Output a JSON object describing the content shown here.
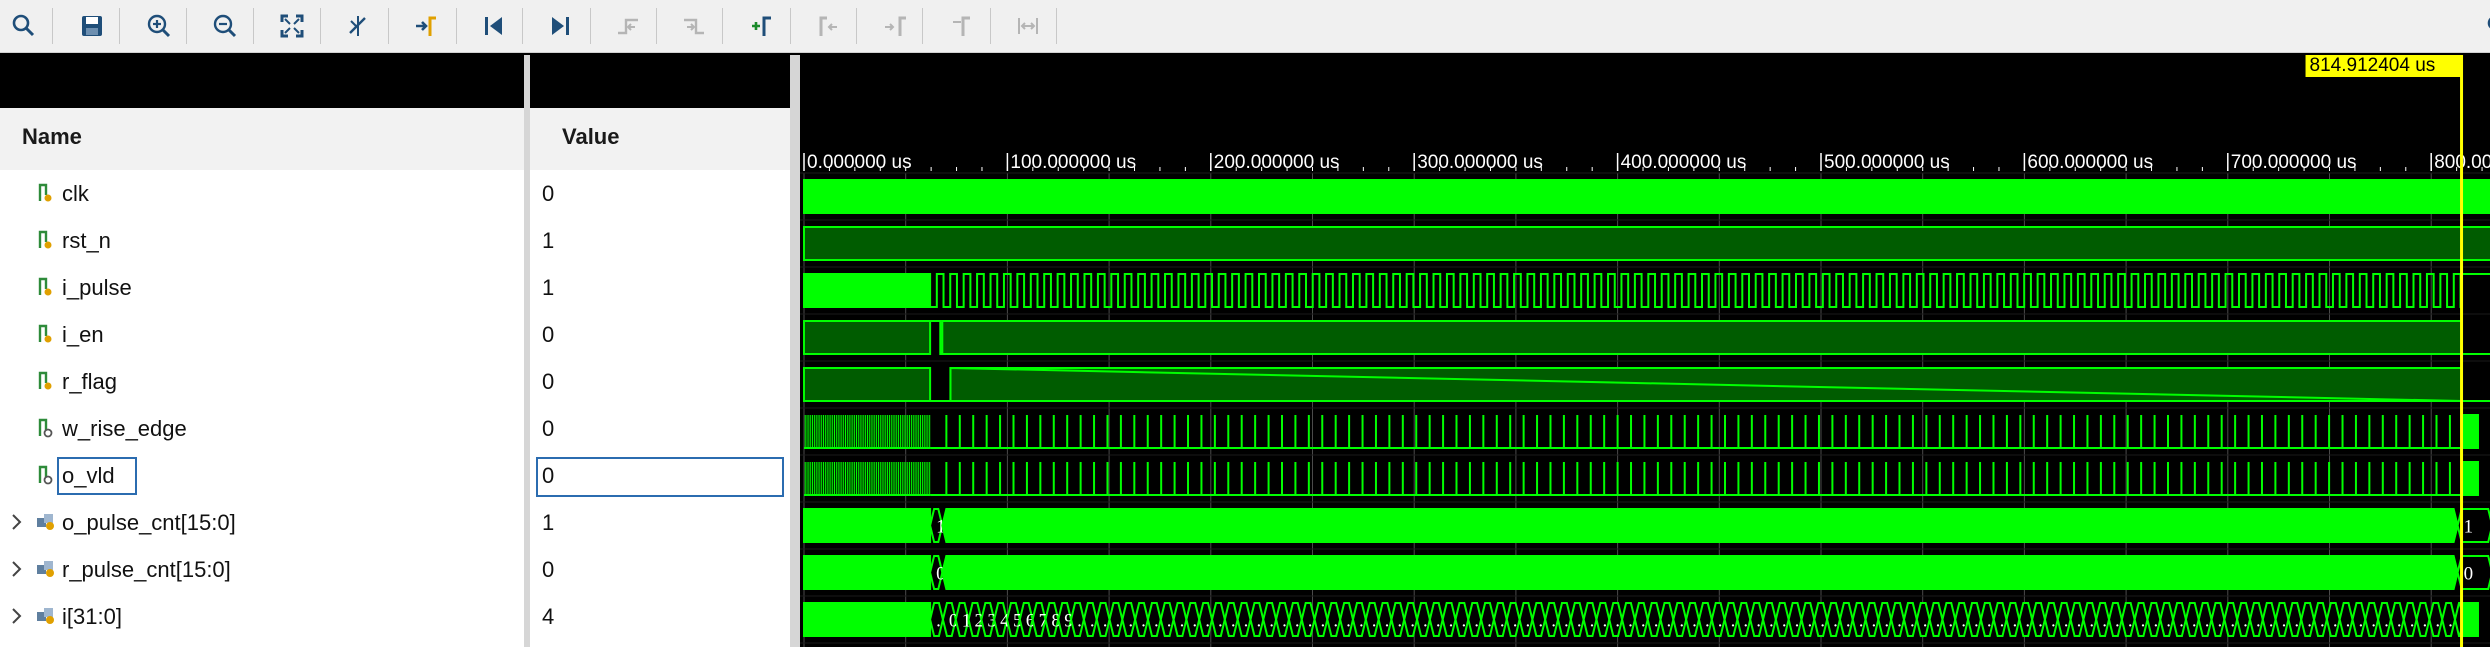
{
  "toolbar": {
    "buttons": [
      {
        "icon": "search-icon",
        "enabled": true
      },
      {
        "icon": "save-icon",
        "enabled": true
      },
      {
        "icon": "zoom-in-icon",
        "enabled": true
      },
      {
        "icon": "zoom-out-icon",
        "enabled": true
      },
      {
        "icon": "zoom-fit-icon",
        "enabled": true
      },
      {
        "icon": "cursor-to-zero-icon",
        "enabled": true
      },
      {
        "icon": "go-to-cursor-icon",
        "enabled": true
      },
      {
        "icon": "go-to-start-icon",
        "enabled": true
      },
      {
        "icon": "go-to-end-icon",
        "enabled": true
      },
      {
        "icon": "previous-transition-icon",
        "enabled": false
      },
      {
        "icon": "next-transition-icon",
        "enabled": false
      },
      {
        "icon": "add-marker-icon",
        "enabled": true
      },
      {
        "icon": "previous-marker-icon",
        "enabled": false
      },
      {
        "icon": "next-marker-icon",
        "enabled": false
      },
      {
        "icon": "swap-cursors-icon",
        "enabled": false
      },
      {
        "icon": "measure-icon",
        "enabled": false
      }
    ]
  },
  "columns": {
    "name_header": "Name",
    "value_header": "Value"
  },
  "cursor": {
    "label": "814.912404 us",
    "time_us": 814.912404
  },
  "timeline": {
    "ticks": [
      "0.000000 us",
      "100.000000 us",
      "200.000000 us",
      "300.000000 us",
      "400.000000 us",
      "500.000000 us",
      "600.000000 us",
      "700.000000 us",
      "800.000000 us"
    ],
    "range_us": [
      0,
      830
    ]
  },
  "signals": [
    {
      "name": "clk",
      "value": "0",
      "kind": "logic",
      "expandable": false
    },
    {
      "name": "rst_n",
      "value": "1",
      "kind": "logic",
      "expandable": false
    },
    {
      "name": "i_pulse",
      "value": "1",
      "kind": "logic",
      "expandable": false
    },
    {
      "name": "i_en",
      "value": "0",
      "kind": "logic",
      "expandable": false
    },
    {
      "name": "r_flag",
      "value": "0",
      "kind": "logic",
      "expandable": false
    },
    {
      "name": "w_rise_edge",
      "value": "0",
      "kind": "wire",
      "expandable": false
    },
    {
      "name": "o_vld",
      "value": "0",
      "kind": "wire",
      "expandable": false,
      "selected": true
    },
    {
      "name": "o_pulse_cnt[15:0]",
      "value": "1",
      "kind": "bus",
      "expandable": true,
      "wave_labels": [
        "1",
        "1"
      ]
    },
    {
      "name": "r_pulse_cnt[15:0]",
      "value": "0",
      "kind": "bus",
      "expandable": true,
      "wave_labels": [
        "0",
        "0"
      ]
    },
    {
      "name": "i[31:0]",
      "value": "4",
      "kind": "bus",
      "expandable": true,
      "wave_labels": [
        ".",
        "0",
        "1",
        "2",
        "3",
        "4",
        "5",
        "6",
        "7",
        "8",
        "9",
        "."
      ]
    }
  ],
  "colors": {
    "wave": "#00ff00",
    "wave_fill": "#005c00",
    "cursor": "#ffff00",
    "selection": "#2b6cb0"
  }
}
